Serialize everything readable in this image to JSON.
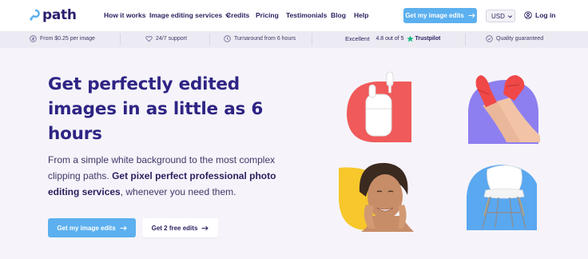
{
  "header": {
    "logo_text": "path",
    "nav": {
      "how_it_works": "How it works",
      "services": "Image editing services",
      "credits": "Credits",
      "pricing": "Pricing",
      "testimonials": "Testimonials",
      "blog": "Blog",
      "help": "Help"
    },
    "cta_label": "Get my image edits",
    "currency": "USD",
    "login_label": "Log in"
  },
  "benefits": {
    "price": "From $0.25 per image",
    "support": "24/7 support",
    "turnaround": "Turnaround from 6 hours",
    "trustpilot": {
      "label": "Excellent",
      "rating": "4.8 out of 5",
      "brand": "Trustpilot"
    },
    "quality": "Quality guaranteed"
  },
  "hero": {
    "headline": "Get perfectly edited images in as little as 6 hours",
    "sub_pre": "From a simple white background to the most complex clipping paths. ",
    "sub_bold": "Get pixel perfect professional photo editing services",
    "sub_post": ", whenever you need them.",
    "primary_label": "Get my image edits",
    "secondary_label": "Get 2 free edits"
  },
  "images": {
    "airpods": {
      "shape_color": "#f05a5a"
    },
    "legs": {
      "shape_color": "#8e7ff0"
    },
    "face": {
      "shape_color": "#f7c72c"
    },
    "chair": {
      "shape_color": "#5aa8f0"
    }
  },
  "colors": {
    "accent": "#5cb0ef",
    "brand": "#2e2484",
    "trustpilot_green": "#00b67a"
  }
}
